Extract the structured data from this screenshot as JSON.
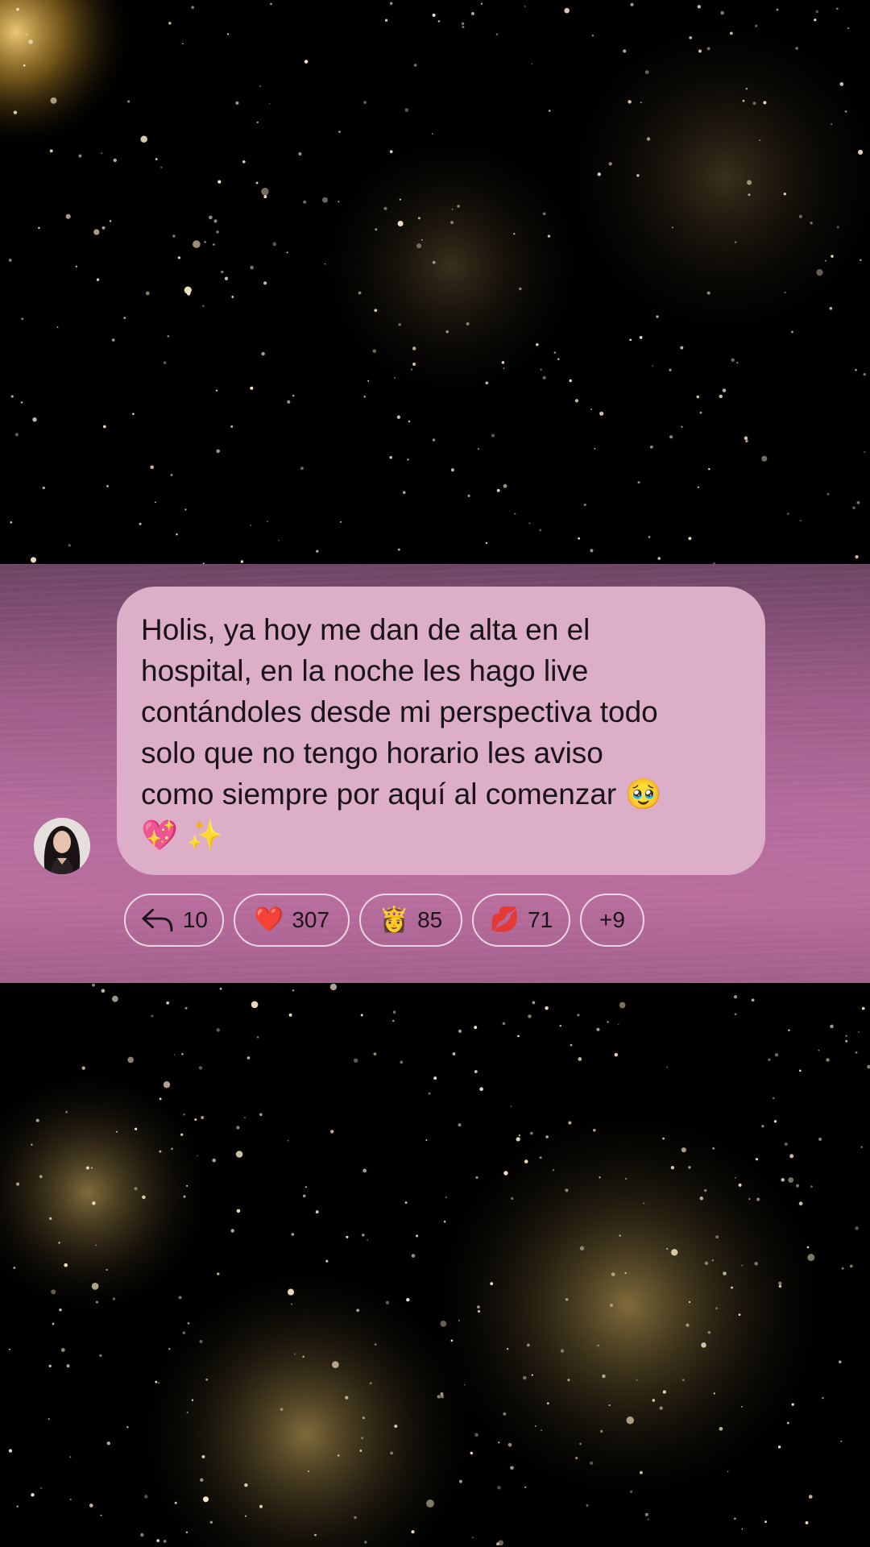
{
  "message": {
    "text": "Holis, ya hoy me dan de alta en el\nhospital, en la noche les hago live\ncontándoles desde mi perspectiva todo\nsolo que no tengo horario les aviso\ncomo siempre por aquí al comenzar 🥹\n💖 ✨"
  },
  "reactions": {
    "reply": {
      "icon": "reply-arrow-icon",
      "count": "10"
    },
    "heart": {
      "emoji": "❤️",
      "count": "307"
    },
    "woman": {
      "emoji": "👸",
      "count": "85"
    },
    "kiss": {
      "emoji": "💋",
      "count": "71"
    },
    "more": {
      "label": "+9"
    }
  },
  "colors": {
    "bubble": "#ddaec8",
    "band": "#b46c9c",
    "background": "#000000",
    "sparkle": "#f4d9a3"
  }
}
